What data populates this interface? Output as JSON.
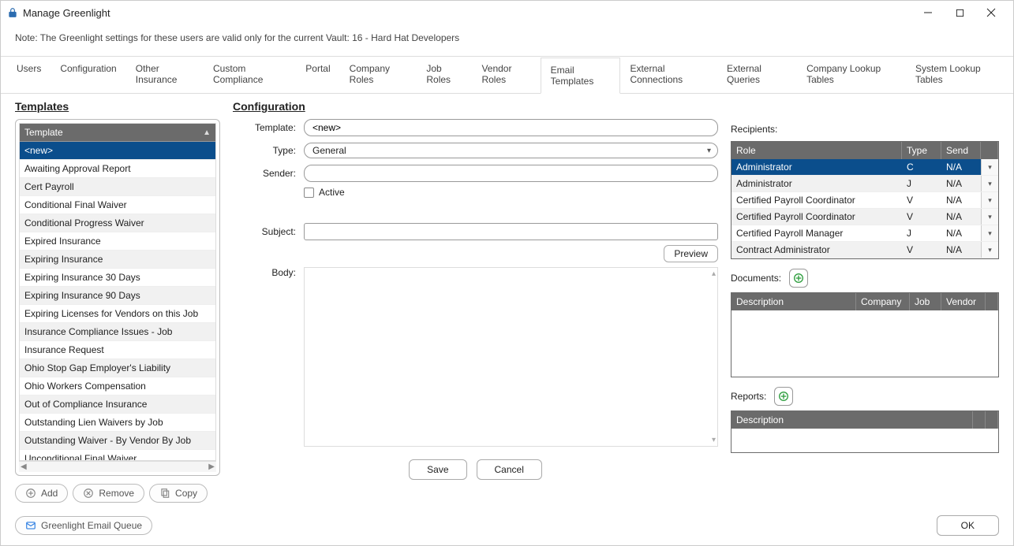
{
  "window": {
    "title": "Manage Greenlight"
  },
  "note": "Note:  The Greenlight settings for these users are valid only for the current Vault: 16 - Hard Hat Developers",
  "tabs": [
    {
      "label": "Users"
    },
    {
      "label": "Configuration"
    },
    {
      "label": "Other Insurance"
    },
    {
      "label": "Custom Compliance"
    },
    {
      "label": "Portal"
    },
    {
      "label": "Company Roles"
    },
    {
      "label": "Job Roles"
    },
    {
      "label": "Vendor Roles"
    },
    {
      "label": "Email Templates",
      "active": true
    },
    {
      "label": "External Connections"
    },
    {
      "label": "External Queries"
    },
    {
      "label": "Company Lookup Tables"
    },
    {
      "label": "System Lookup Tables"
    }
  ],
  "templates": {
    "header": "Templates",
    "column": "Template",
    "items": [
      {
        "label": "<new>",
        "selected": true
      },
      {
        "label": "Awaiting Approval Report"
      },
      {
        "label": "Cert Payroll"
      },
      {
        "label": "Conditional Final Waiver"
      },
      {
        "label": "Conditional Progress Waiver"
      },
      {
        "label": "Expired Insurance"
      },
      {
        "label": "Expiring Insurance"
      },
      {
        "label": "Expiring Insurance 30 Days"
      },
      {
        "label": "Expiring Insurance 90 Days"
      },
      {
        "label": "Expiring Licenses for Vendors on this Job"
      },
      {
        "label": "Insurance Compliance Issues - Job"
      },
      {
        "label": "Insurance Request"
      },
      {
        "label": "Ohio Stop Gap Employer's Liability"
      },
      {
        "label": "Ohio Workers Compensation"
      },
      {
        "label": "Out of Compliance Insurance"
      },
      {
        "label": "Outstanding Lien Waivers by Job"
      },
      {
        "label": "Outstanding Waiver - By Vendor By Job"
      },
      {
        "label": "Unconditional Final Waiver"
      }
    ],
    "buttons": {
      "add": "Add",
      "remove": "Remove",
      "copy": "Copy"
    }
  },
  "config": {
    "header": "Configuration",
    "labels": {
      "template": "Template:",
      "type": "Type:",
      "sender": "Sender:",
      "active": "Active",
      "subject": "Subject:",
      "body": "Body:"
    },
    "template_value": "<new>",
    "type_value": "General",
    "sender_value": "",
    "active_checked": false,
    "subject_value": "",
    "body_value": "",
    "buttons": {
      "preview": "Preview",
      "save": "Save",
      "cancel": "Cancel"
    }
  },
  "recipients": {
    "header": "Recipients:",
    "columns": {
      "role": "Role",
      "type": "Type",
      "send": "Send"
    },
    "rows": [
      {
        "role": "Administrator",
        "type": "C",
        "send": "N/A",
        "selected": true
      },
      {
        "role": "Administrator",
        "type": "J",
        "send": "N/A"
      },
      {
        "role": "Certified Payroll Coordinator",
        "type": "V",
        "send": "N/A"
      },
      {
        "role": "Certified Payroll Coordinator",
        "type": "V",
        "send": "N/A"
      },
      {
        "role": "Certified Payroll Manager",
        "type": "J",
        "send": "N/A"
      },
      {
        "role": "Contract Administrator",
        "type": "V",
        "send": "N/A"
      }
    ]
  },
  "documents": {
    "header": "Documents:",
    "columns": {
      "description": "Description",
      "company": "Company",
      "job": "Job",
      "vendor": "Vendor"
    }
  },
  "reports": {
    "header": "Reports:",
    "columns": {
      "description": "Description"
    }
  },
  "footer": {
    "queue": "Greenlight Email Queue",
    "ok": "OK"
  }
}
